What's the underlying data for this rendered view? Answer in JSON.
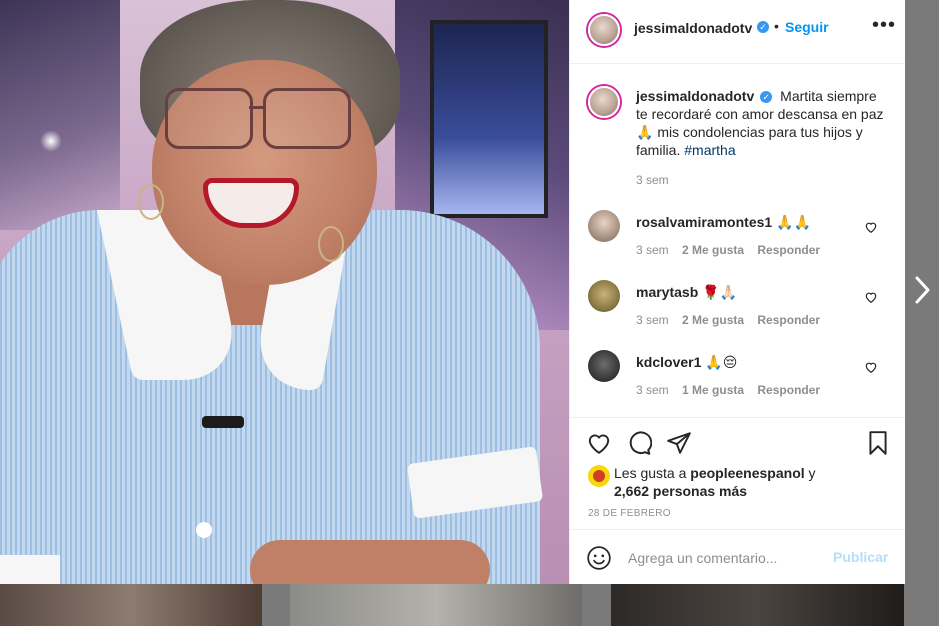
{
  "post": {
    "username": "jessimaldonadotv",
    "verified_mark": "✓",
    "dot": "•",
    "follow_label": "Seguir",
    "more_label": "•••",
    "caption_text": "Martita siempre te recordaré con amor descansa en paz 🙏 mis condolencias para tus hijos y familia.",
    "caption_hashtag": "#martha",
    "caption_time": "3 sem"
  },
  "comments": [
    {
      "username": "rosalvamiramontes1",
      "text": "🙏🙏",
      "time": "3 sem",
      "likes": "2 Me gusta",
      "reply": "Responder"
    },
    {
      "username": "marytasb",
      "text": "🌹🙏🏻",
      "time": "3 sem",
      "likes": "2 Me gusta",
      "reply": "Responder"
    },
    {
      "username": "kdclover1",
      "text": "🙏😔",
      "time": "3 sem",
      "likes": "1 Me gusta",
      "reply": "Responder"
    }
  ],
  "likes": {
    "prefix": "Les gusta a",
    "user": "peopleenespanol",
    "and": "y",
    "count_text": "2,662 personas más"
  },
  "date": "28 DE FEBRERO",
  "add_comment": {
    "placeholder": "Agrega un comentario...",
    "publish_label": "Publicar"
  },
  "icons": {
    "like": "heart-icon",
    "comment": "comment-icon",
    "share": "paper-plane-icon",
    "save": "bookmark-icon",
    "emoji": "smiley-icon",
    "next": "chevron-right-icon"
  },
  "colors": {
    "link_blue": "#0095f6",
    "verified_blue": "#3897f0",
    "hashtag": "#00376b",
    "muted": "#8e8e8e",
    "publish_disabled": "#b2dffc"
  }
}
